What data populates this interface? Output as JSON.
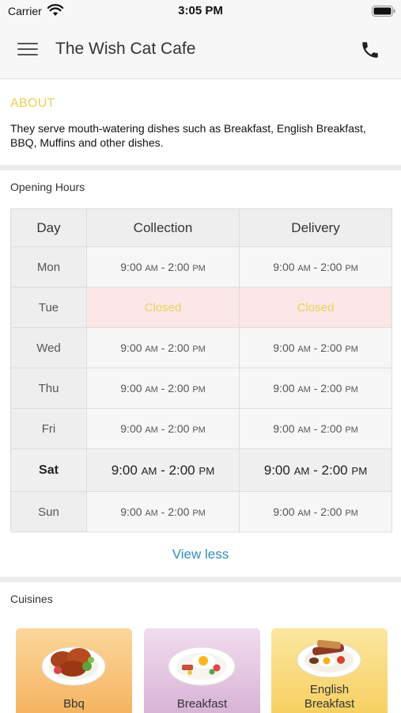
{
  "status_bar": {
    "carrier": "Carrier",
    "time": "3:05 PM",
    "wifi_icon": "wifi-icon",
    "battery_icon": "battery-icon"
  },
  "header": {
    "title": "The Wish Cat Cafe",
    "menu_icon": "hamburger-menu-icon",
    "phone_icon": "phone-icon"
  },
  "about": {
    "heading": "ABOUT",
    "text": "They serve mouth-watering dishes such as Breakfast, English Breakfast, BBQ, Muffins and other dishes."
  },
  "opening_hours": {
    "heading": "Opening Hours",
    "columns": [
      "Day",
      "Collection",
      "Delivery"
    ],
    "rows": [
      {
        "day": "Mon",
        "collection": "9:00 AM - 2:00 PM",
        "delivery": "9:00 AM - 2:00 PM",
        "closed": false,
        "today": false
      },
      {
        "day": "Tue",
        "collection": "Closed",
        "delivery": "Closed",
        "closed": true,
        "today": false
      },
      {
        "day": "Wed",
        "collection": "9:00 AM - 2:00 PM",
        "delivery": "9:00 AM - 2:00 PM",
        "closed": false,
        "today": false
      },
      {
        "day": "Thu",
        "collection": "9:00 AM - 2:00 PM",
        "delivery": "9:00 AM - 2:00 PM",
        "closed": false,
        "today": false
      },
      {
        "day": "Fri",
        "collection": "9:00 AM - 2:00 PM",
        "delivery": "9:00 AM - 2:00 PM",
        "closed": false,
        "today": false
      },
      {
        "day": "Sat",
        "collection": "9:00 AM - 2:00 PM",
        "delivery": "9:00 AM - 2:00 PM",
        "closed": false,
        "today": true
      },
      {
        "day": "Sun",
        "collection": "9:00 AM - 2:00 PM",
        "delivery": "9:00 AM - 2:00 PM",
        "closed": false,
        "today": false
      }
    ],
    "toggle_label": "View less"
  },
  "cuisines": {
    "heading": "Cuisines",
    "items": [
      {
        "label": "Bbq",
        "icon": "bbq-dish-icon"
      },
      {
        "label": "Breakfast",
        "icon": "breakfast-dish-icon"
      },
      {
        "label": "English\nBreakfast",
        "icon": "english-breakfast-dish-icon"
      }
    ]
  },
  "colors": {
    "accent_yellow": "#e9d152",
    "closed_bg": "#fbe7e7",
    "link_blue": "#2d8fc0"
  }
}
